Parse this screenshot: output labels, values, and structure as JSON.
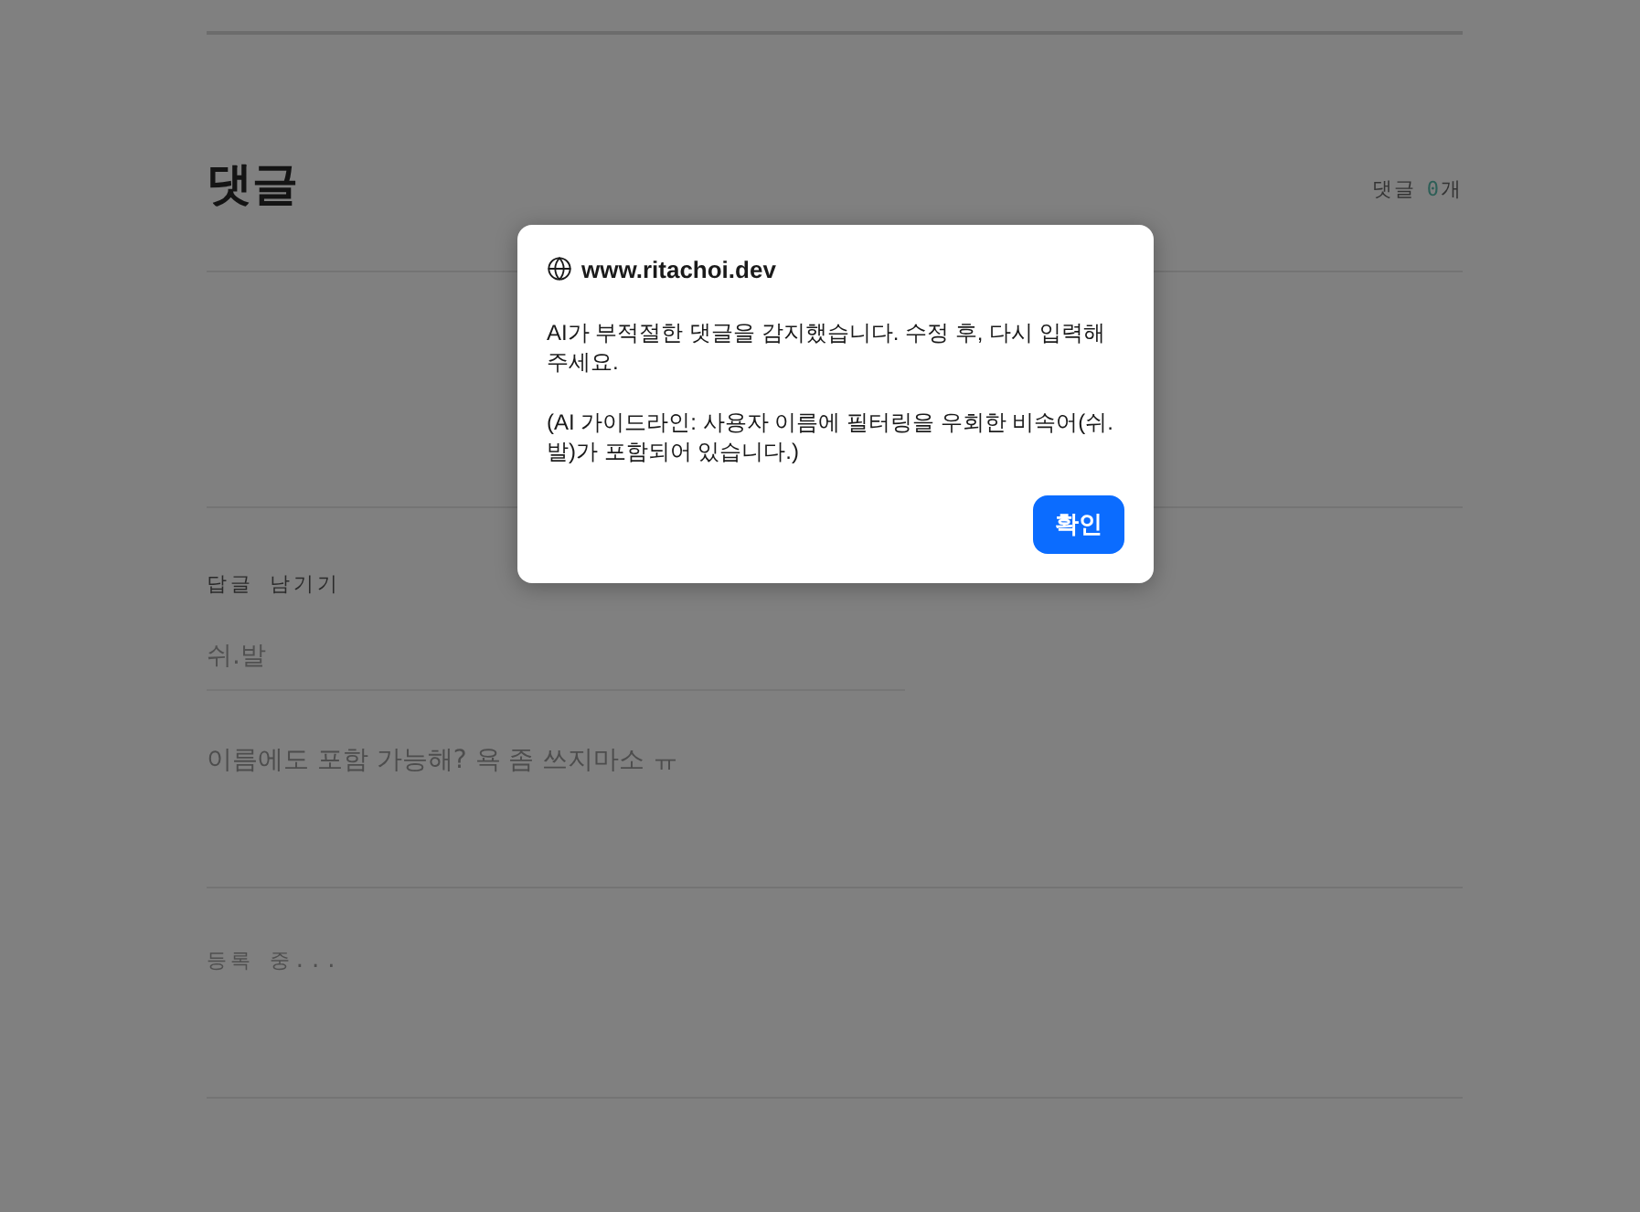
{
  "comments": {
    "title": "댓글",
    "count_label": "댓글",
    "count": "0",
    "count_unit": "개"
  },
  "reply_form": {
    "label": "답글 남기기",
    "name_field": {
      "value": "쉬.발"
    },
    "message_field": {
      "value": "이름에도 포함 가능해? 욕 좀 쓰지마소 ㅠ"
    },
    "submit_button": {
      "label": "등록 중...",
      "disabled": true
    }
  },
  "dialog": {
    "origin": "www.ritachoi.dev",
    "message": "AI가 부적절한 댓글을 감지했습니다. 수정 후, 다시 입력해 주세요.",
    "detail": "(AI 가이드라인: 사용자 이름에 필터링을 우회한 비속어(쉬.발)가 포함되어 있습니다.)",
    "button": "확인"
  }
}
